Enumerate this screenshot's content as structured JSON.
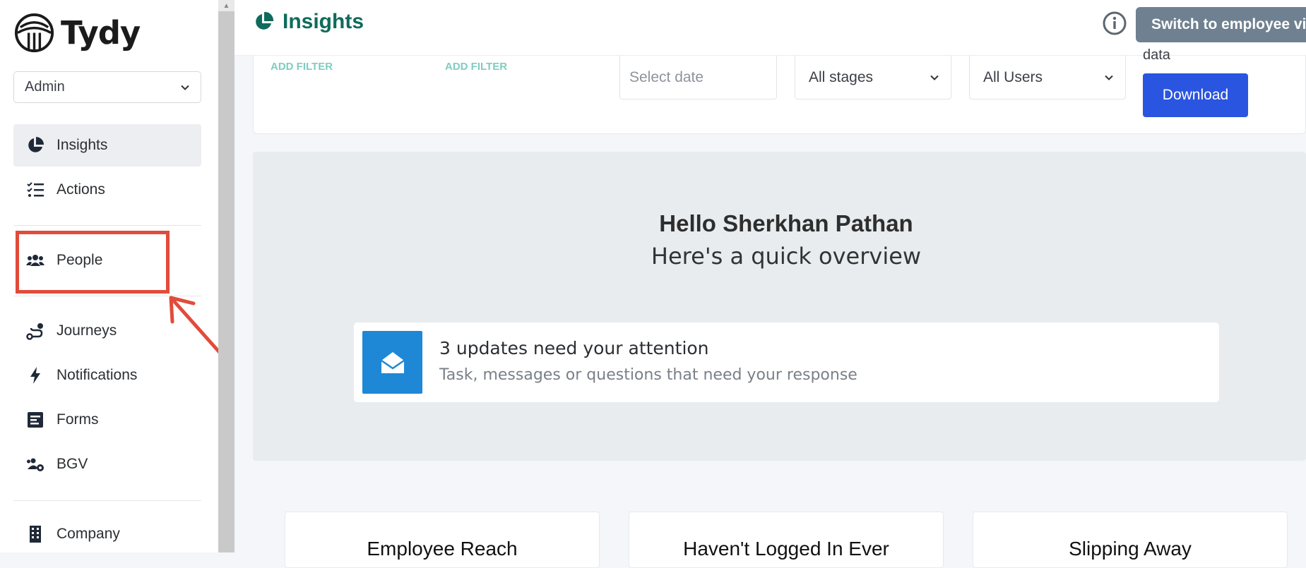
{
  "brand": {
    "name": "Tydy"
  },
  "role_select": {
    "value": "Admin"
  },
  "sidebar": {
    "items": [
      {
        "label": "Insights",
        "icon": "pie-chart-icon",
        "active": true
      },
      {
        "label": "Actions",
        "icon": "checklist-icon"
      },
      {
        "label": "People",
        "icon": "users-icon"
      },
      {
        "label": "Journeys",
        "icon": "route-icon"
      },
      {
        "label": "Notifications",
        "icon": "bolt-icon"
      },
      {
        "label": "Forms",
        "icon": "form-icon"
      },
      {
        "label": "BGV",
        "icon": "users-gear-icon"
      },
      {
        "label": "Company",
        "icon": "building-icon"
      }
    ]
  },
  "header": {
    "title": "Insights",
    "switch_label": "Switch to employee view"
  },
  "filters": {
    "add_filter_1": "ADD FILTER",
    "add_filter_2": "ADD FILTER",
    "date_placeholder": "Select date",
    "stages_value": "All stages",
    "users_value": "All Users",
    "data_label": "data",
    "download_label": "Download"
  },
  "overview": {
    "greeting": "Hello Sherkhan Pathan",
    "subtitle": "Here's a quick overview",
    "updates_title": "3 updates need your attention",
    "updates_subtitle": "Task, messages or questions that need your response"
  },
  "stats": [
    {
      "title": "Employee Reach"
    },
    {
      "title": "Haven't Logged In Ever"
    },
    {
      "title": "Slipping Away"
    }
  ],
  "colors": {
    "brand_green": "#0f6b5c",
    "primary_blue": "#2a55e0",
    "annotation_red": "#e24b3b",
    "switch_gray": "#6f8190"
  }
}
